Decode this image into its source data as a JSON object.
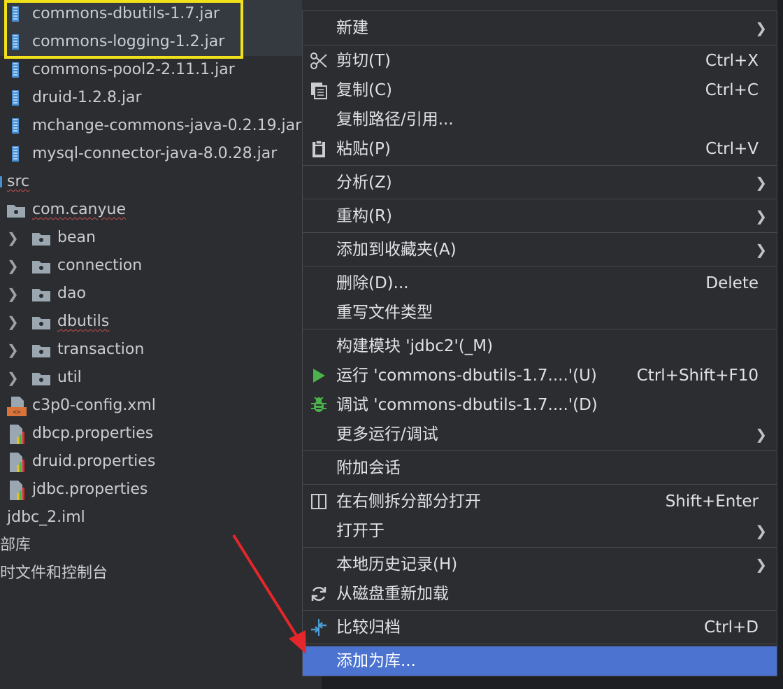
{
  "tree": {
    "items": [
      {
        "label": "commons-dbutils-1.7.jar",
        "kind": "jar"
      },
      {
        "label": "commons-logging-1.2.jar",
        "kind": "jar"
      },
      {
        "label": "commons-pool2-2.11.1.jar",
        "kind": "jar"
      },
      {
        "label": "druid-1.2.8.jar",
        "kind": "jar"
      },
      {
        "label": "mchange-commons-java-0.2.19.jar",
        "kind": "jar"
      },
      {
        "label": "mysql-connector-java-8.0.28.jar",
        "kind": "jar"
      },
      {
        "label": "src",
        "kind": "source-root"
      },
      {
        "label": "com.canyue",
        "kind": "package"
      },
      {
        "label": "bean",
        "kind": "package"
      },
      {
        "label": "connection",
        "kind": "package"
      },
      {
        "label": "dao",
        "kind": "package"
      },
      {
        "label": "dbutils",
        "kind": "package"
      },
      {
        "label": "transaction",
        "kind": "package"
      },
      {
        "label": "util",
        "kind": "package"
      },
      {
        "label": "c3p0-config.xml",
        "kind": "xml-file"
      },
      {
        "label": "dbcp.properties",
        "kind": "properties-file"
      },
      {
        "label": "druid.properties",
        "kind": "properties-file"
      },
      {
        "label": "jdbc.properties",
        "kind": "properties-file"
      },
      {
        "label": "jdbc_2.iml",
        "kind": "iml-file"
      },
      {
        "label": "部库",
        "kind": "node"
      },
      {
        "label": "时文件和控制台",
        "kind": "node"
      }
    ]
  },
  "menu": {
    "items": [
      {
        "label": "新建",
        "shortcut": "",
        "submenu": true,
        "icon": ""
      },
      {
        "label": "剪切(T)",
        "shortcut": "Ctrl+X",
        "submenu": false,
        "icon": "scissors-icon"
      },
      {
        "label": "复制(C)",
        "shortcut": "Ctrl+C",
        "submenu": false,
        "icon": "copy-icon"
      },
      {
        "label": "复制路径/引用...",
        "shortcut": "",
        "submenu": false,
        "icon": ""
      },
      {
        "label": "粘贴(P)",
        "shortcut": "Ctrl+V",
        "submenu": false,
        "icon": "paste-icon"
      },
      {
        "label": "分析(Z)",
        "shortcut": "",
        "submenu": true,
        "icon": ""
      },
      {
        "label": "重构(R)",
        "shortcut": "",
        "submenu": true,
        "icon": ""
      },
      {
        "label": "添加到收藏夹(A)",
        "shortcut": "",
        "submenu": true,
        "icon": ""
      },
      {
        "label": "删除(D)...",
        "shortcut": "Delete",
        "submenu": false,
        "icon": ""
      },
      {
        "label": "重写文件类型",
        "shortcut": "",
        "submenu": false,
        "icon": ""
      },
      {
        "label": "构建模块 'jdbc2'(_M)",
        "shortcut": "",
        "submenu": false,
        "icon": ""
      },
      {
        "label": "运行 'commons-dbutils-1.7....'(U)",
        "shortcut": "Ctrl+Shift+F10",
        "submenu": false,
        "icon": "run-icon"
      },
      {
        "label": "调试 'commons-dbutils-1.7....'(D)",
        "shortcut": "",
        "submenu": false,
        "icon": "debug-icon"
      },
      {
        "label": "更多运行/调试",
        "shortcut": "",
        "submenu": true,
        "icon": ""
      },
      {
        "label": "附加会话",
        "shortcut": "",
        "submenu": false,
        "icon": ""
      },
      {
        "label": "在右侧拆分部分打开",
        "shortcut": "Shift+Enter",
        "submenu": false,
        "icon": "split-icon"
      },
      {
        "label": "打开于",
        "shortcut": "",
        "submenu": true,
        "icon": ""
      },
      {
        "label": "本地历史记录(H)",
        "shortcut": "",
        "submenu": true,
        "icon": ""
      },
      {
        "label": "从磁盘重新加载",
        "shortcut": "",
        "submenu": false,
        "icon": "reload-icon"
      },
      {
        "label": "比较归档",
        "shortcut": "Ctrl+D",
        "submenu": false,
        "icon": "compare-icon"
      },
      {
        "label": "添加为库...",
        "shortcut": "",
        "submenu": false,
        "icon": ""
      }
    ]
  },
  "colors": {
    "background": "#2b2d30",
    "highlight_box": "#f0e11b",
    "menu_active": "#4b73cf",
    "arrow": "#e5262b",
    "run_green": "#4bb34b"
  }
}
